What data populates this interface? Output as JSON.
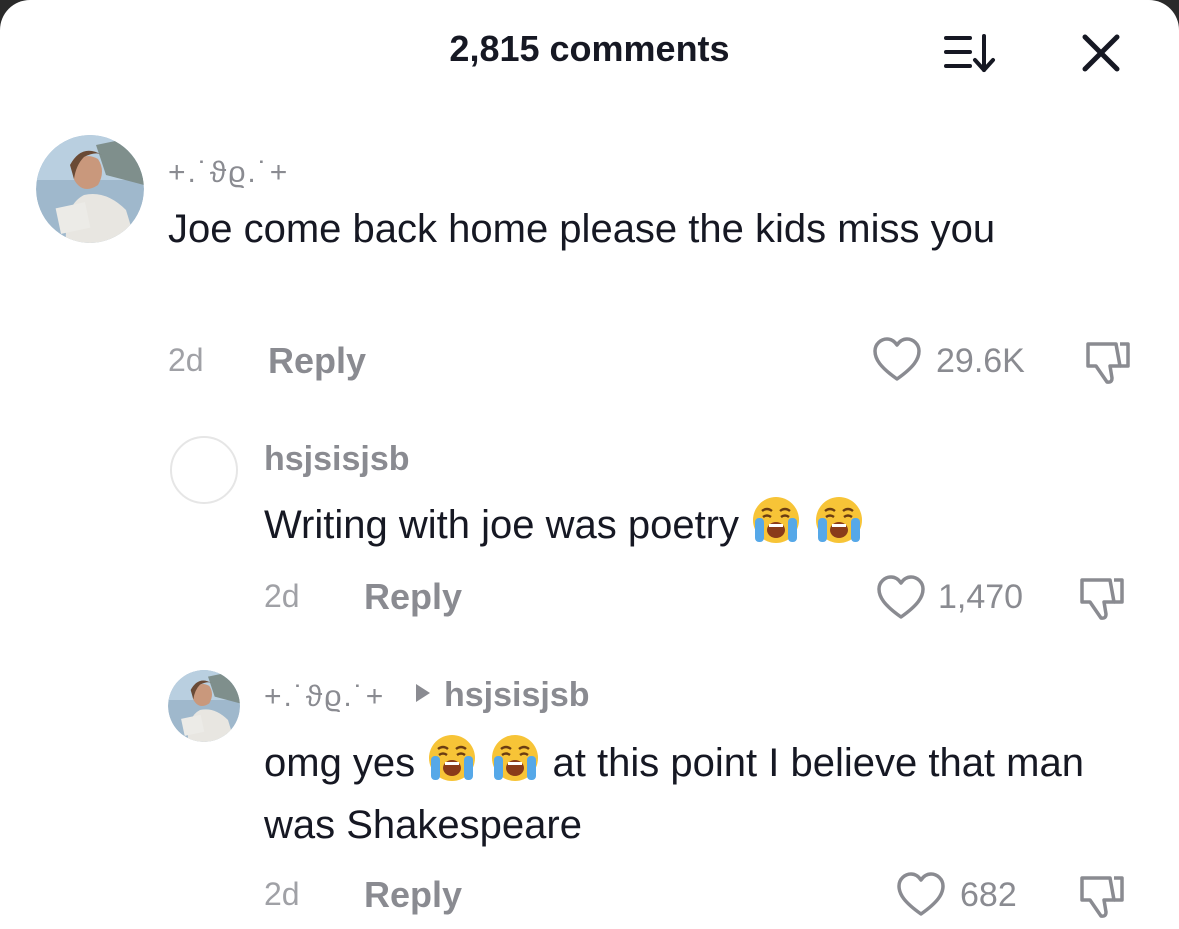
{
  "header": {
    "title": "2,815 comments",
    "sort_icon": "sort-icon",
    "close_icon": "close-icon"
  },
  "comments": [
    {
      "username": "+.˙ϑϱ.˙+",
      "text": "Joe come back home please the kids miss you",
      "time": "2d",
      "reply_label": "Reply",
      "likes": "29.6K"
    },
    {
      "username": "hsjsisjsb",
      "text_before_emoji": "Writing with joe was poetry",
      "time": "2d",
      "reply_label": "Reply",
      "likes": "1,470"
    },
    {
      "username": "+.˙ϑϱ.˙+",
      "reply_to": "hsjsisjsb",
      "text_part1": "omg yes",
      "text_part2": "at this point I believe that man was Shakespeare",
      "time": "2d",
      "reply_label": "Reply",
      "likes": "682"
    }
  ],
  "icons": {
    "emoji": "loudly-crying-face-emoji",
    "like": "heart-outline-icon",
    "dislike": "thumbs-down-icon"
  },
  "colors": {
    "primary_text": "#161823",
    "secondary_text": "#8a8b91"
  }
}
